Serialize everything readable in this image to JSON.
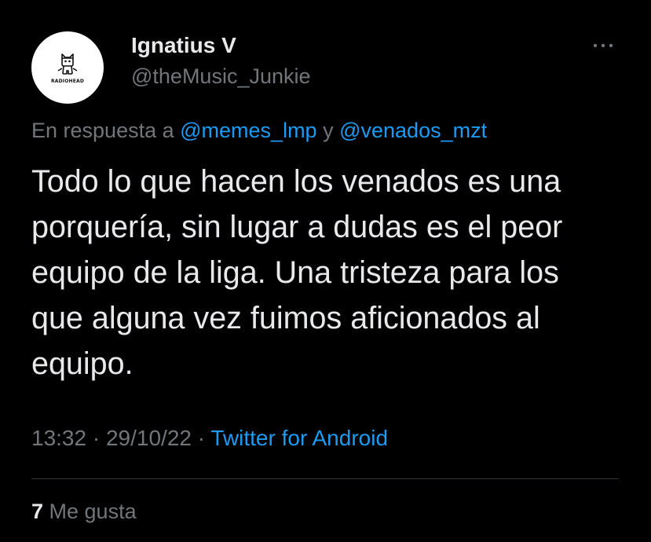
{
  "author": {
    "display_name": "Ignatius V",
    "handle": "@theMusic_Junkie",
    "avatar_logo_text": "RADIOHEAD"
  },
  "reply_context": {
    "prefix": "En respuesta a ",
    "mention_1": "@memes_lmp",
    "connector": " y ",
    "mention_2": "@venados_mzt"
  },
  "tweet": {
    "lines": [
      "Todo lo que hacen los venados es una",
      "porquería, sin lugar a dudas es el peor",
      "equipo de la liga. Una tristeza para los",
      "que alguna vez fuimos aficionados al",
      "equipo."
    ]
  },
  "meta": {
    "time": "13:32",
    "separator_1": " · ",
    "date": "29/10/22",
    "separator_2": " · ",
    "source": "Twitter for Android"
  },
  "stats": {
    "likes_count": "7",
    "likes_label": " Me gusta"
  },
  "icons": {
    "more": "more-dots-icon",
    "avatar": "radiohead-bear-logo"
  },
  "colors": {
    "background": "#000000",
    "primary_text": "#e7e9ea",
    "secondary_text": "#71767b",
    "link": "#1d9bf0",
    "divider": "#2f3336"
  }
}
